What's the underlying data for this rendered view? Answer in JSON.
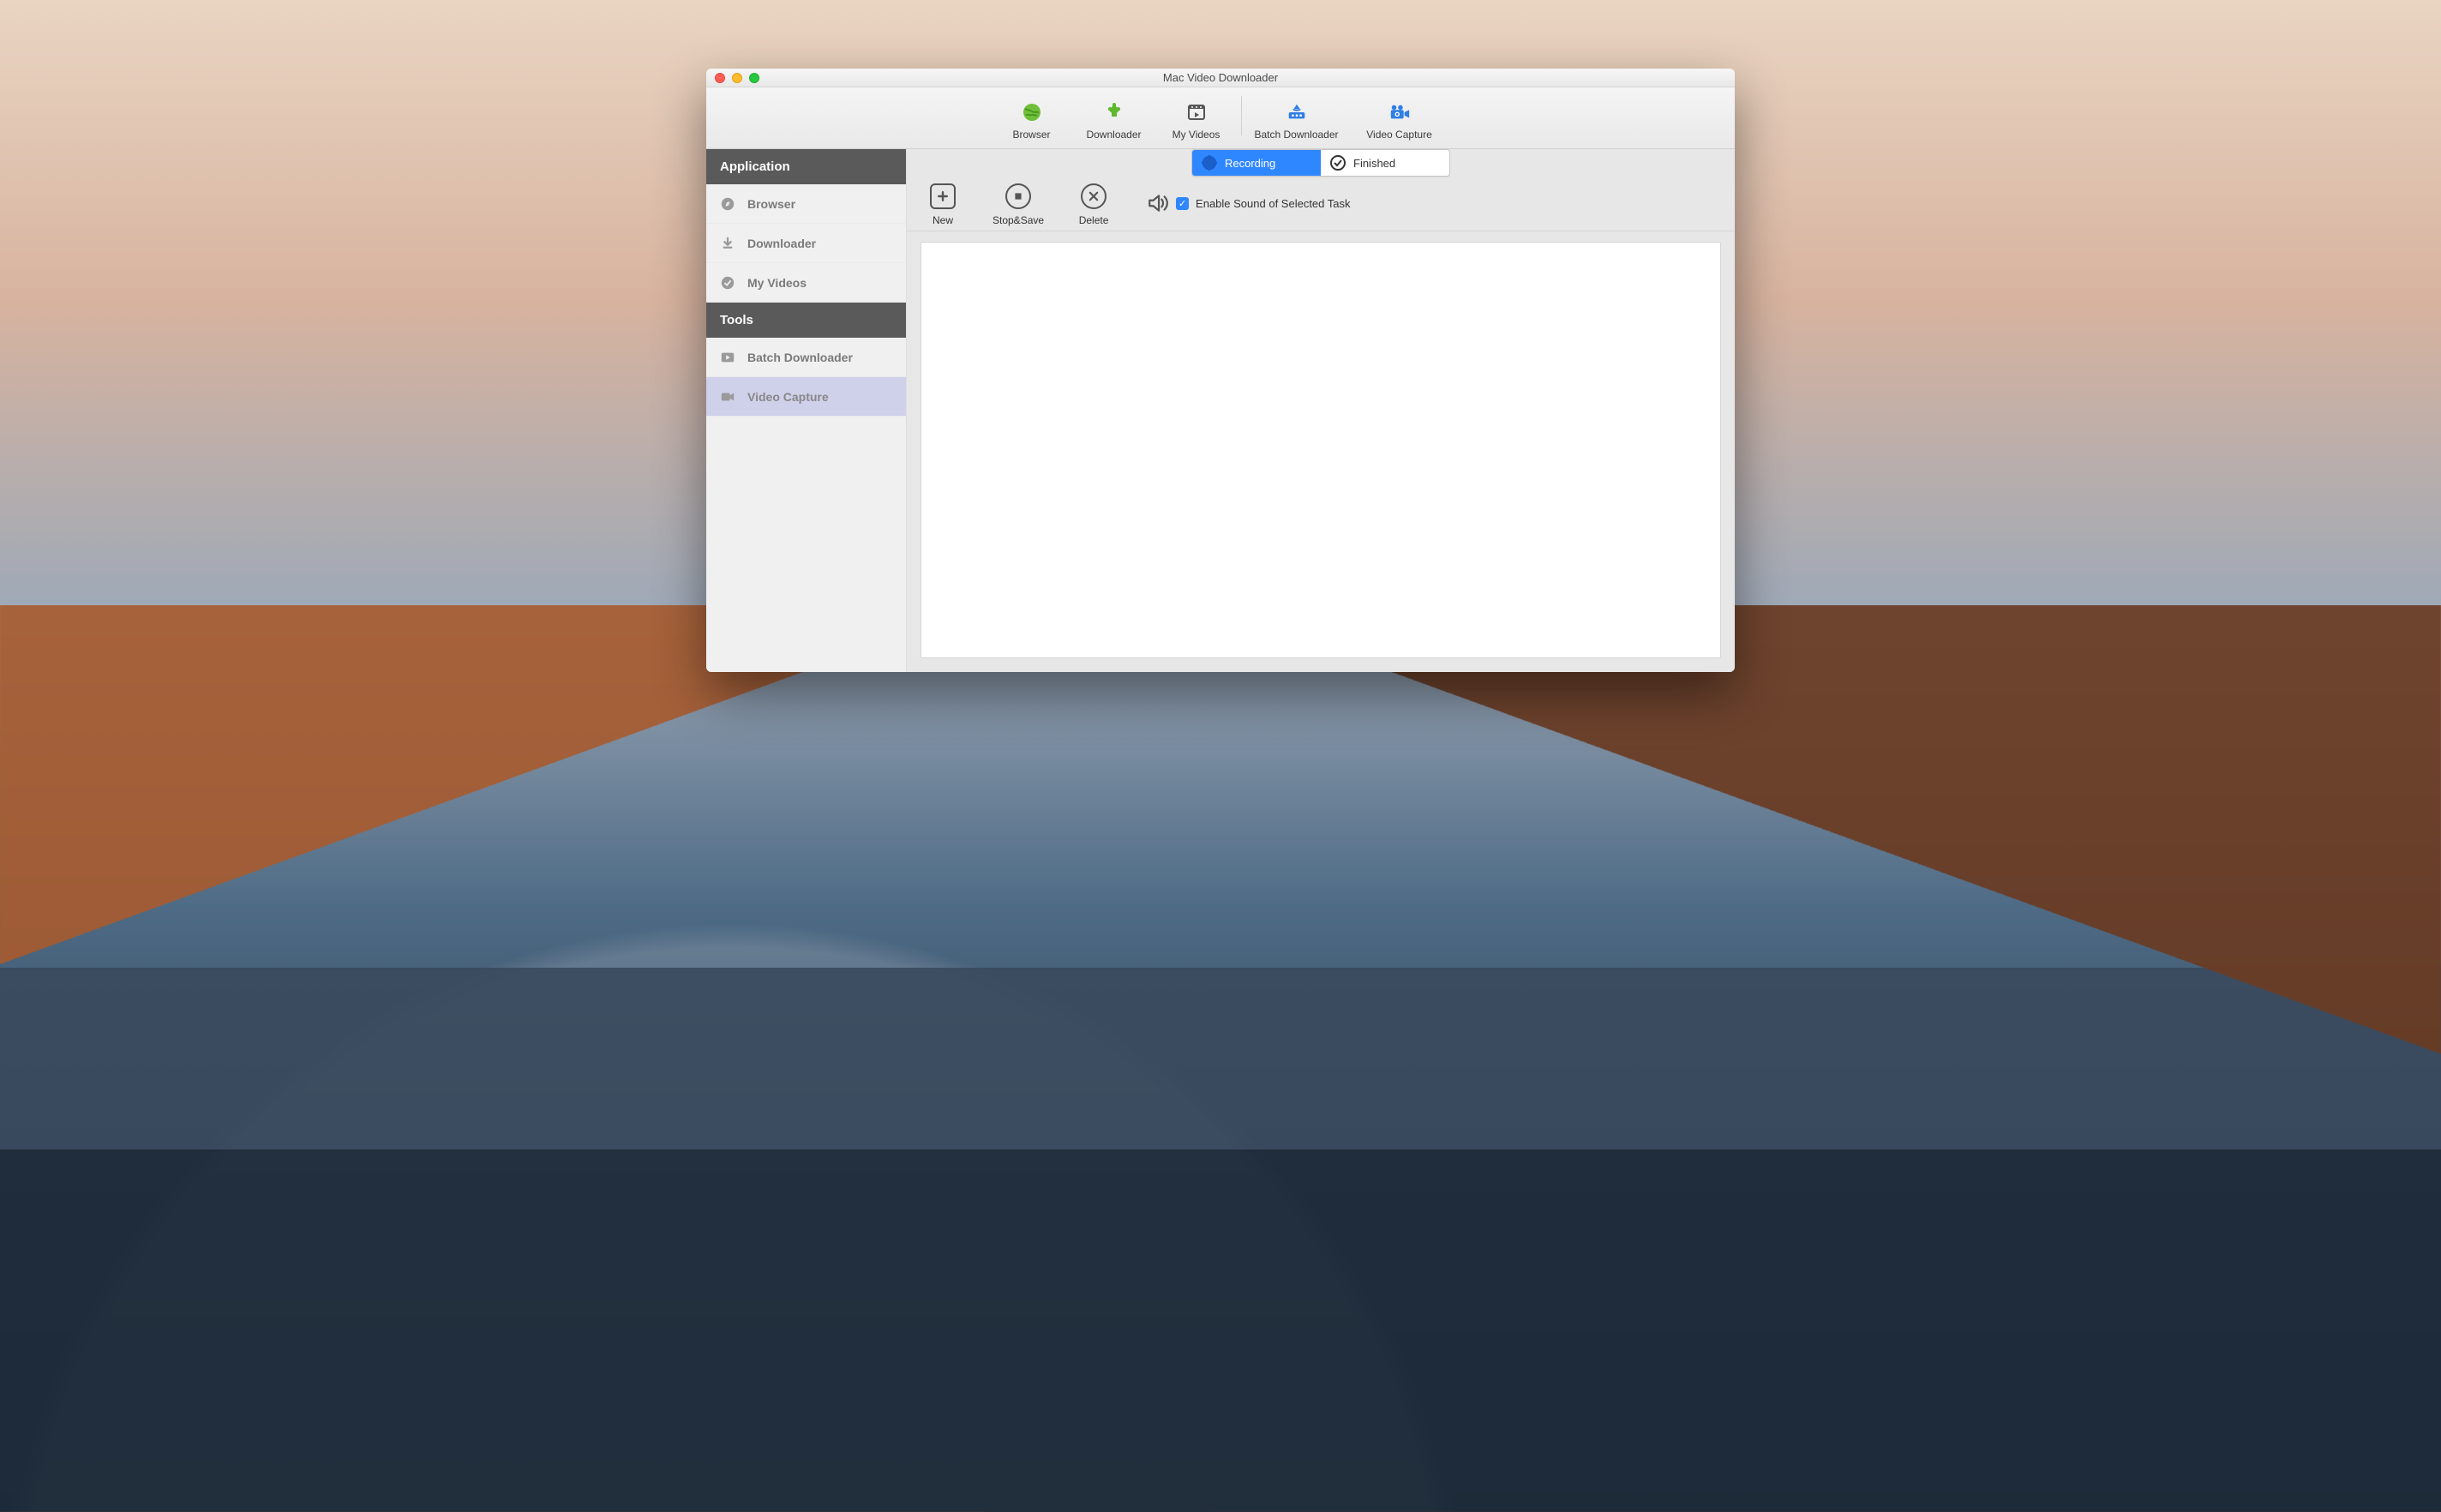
{
  "window": {
    "title": "Mac Video Downloader"
  },
  "toolbar": {
    "items": [
      {
        "label": "Browser"
      },
      {
        "label": "Downloader"
      },
      {
        "label": "My Videos"
      },
      {
        "label": "Batch Downloader"
      },
      {
        "label": "Video Capture"
      }
    ]
  },
  "sidebar": {
    "section_application": "Application",
    "section_tools": "Tools",
    "items_app": [
      {
        "label": "Browser"
      },
      {
        "label": "Downloader"
      },
      {
        "label": "My Videos"
      }
    ],
    "items_tools": [
      {
        "label": "Batch Downloader"
      },
      {
        "label": "Video Capture"
      }
    ],
    "selected": "Video Capture"
  },
  "segmented": {
    "recording": "Recording",
    "finished": "Finished",
    "active": "Recording"
  },
  "actions": {
    "new": "New",
    "stopsave": "Stop&Save",
    "delete": "Delete",
    "enable_sound": "Enable Sound of Selected Task",
    "enable_sound_checked": true
  }
}
